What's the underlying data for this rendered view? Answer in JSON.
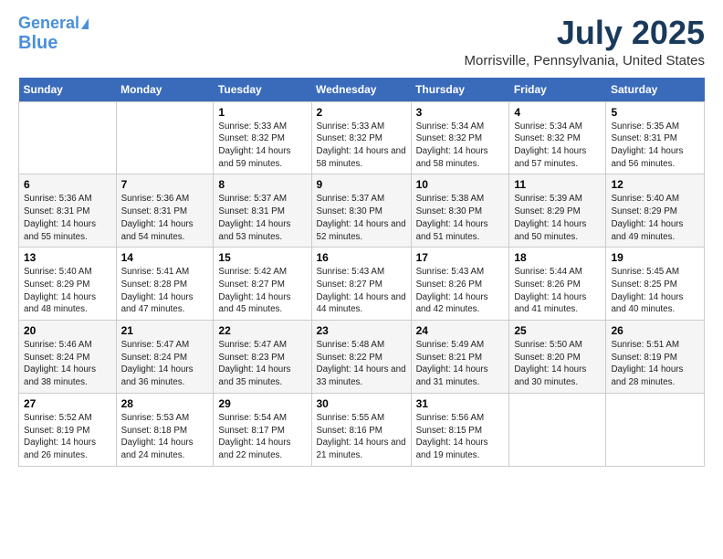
{
  "header": {
    "logo_line1": "General",
    "logo_line2": "Blue",
    "month": "July 2025",
    "location": "Morrisville, Pennsylvania, United States"
  },
  "days_of_week": [
    "Sunday",
    "Monday",
    "Tuesday",
    "Wednesday",
    "Thursday",
    "Friday",
    "Saturday"
  ],
  "weeks": [
    [
      {
        "day": "",
        "info": ""
      },
      {
        "day": "",
        "info": ""
      },
      {
        "day": "1",
        "info": "Sunrise: 5:33 AM\nSunset: 8:32 PM\nDaylight: 14 hours and 59 minutes."
      },
      {
        "day": "2",
        "info": "Sunrise: 5:33 AM\nSunset: 8:32 PM\nDaylight: 14 hours and 58 minutes."
      },
      {
        "day": "3",
        "info": "Sunrise: 5:34 AM\nSunset: 8:32 PM\nDaylight: 14 hours and 58 minutes."
      },
      {
        "day": "4",
        "info": "Sunrise: 5:34 AM\nSunset: 8:32 PM\nDaylight: 14 hours and 57 minutes."
      },
      {
        "day": "5",
        "info": "Sunrise: 5:35 AM\nSunset: 8:31 PM\nDaylight: 14 hours and 56 minutes."
      }
    ],
    [
      {
        "day": "6",
        "info": "Sunrise: 5:36 AM\nSunset: 8:31 PM\nDaylight: 14 hours and 55 minutes."
      },
      {
        "day": "7",
        "info": "Sunrise: 5:36 AM\nSunset: 8:31 PM\nDaylight: 14 hours and 54 minutes."
      },
      {
        "day": "8",
        "info": "Sunrise: 5:37 AM\nSunset: 8:31 PM\nDaylight: 14 hours and 53 minutes."
      },
      {
        "day": "9",
        "info": "Sunrise: 5:37 AM\nSunset: 8:30 PM\nDaylight: 14 hours and 52 minutes."
      },
      {
        "day": "10",
        "info": "Sunrise: 5:38 AM\nSunset: 8:30 PM\nDaylight: 14 hours and 51 minutes."
      },
      {
        "day": "11",
        "info": "Sunrise: 5:39 AM\nSunset: 8:29 PM\nDaylight: 14 hours and 50 minutes."
      },
      {
        "day": "12",
        "info": "Sunrise: 5:40 AM\nSunset: 8:29 PM\nDaylight: 14 hours and 49 minutes."
      }
    ],
    [
      {
        "day": "13",
        "info": "Sunrise: 5:40 AM\nSunset: 8:29 PM\nDaylight: 14 hours and 48 minutes."
      },
      {
        "day": "14",
        "info": "Sunrise: 5:41 AM\nSunset: 8:28 PM\nDaylight: 14 hours and 47 minutes."
      },
      {
        "day": "15",
        "info": "Sunrise: 5:42 AM\nSunset: 8:27 PM\nDaylight: 14 hours and 45 minutes."
      },
      {
        "day": "16",
        "info": "Sunrise: 5:43 AM\nSunset: 8:27 PM\nDaylight: 14 hours and 44 minutes."
      },
      {
        "day": "17",
        "info": "Sunrise: 5:43 AM\nSunset: 8:26 PM\nDaylight: 14 hours and 42 minutes."
      },
      {
        "day": "18",
        "info": "Sunrise: 5:44 AM\nSunset: 8:26 PM\nDaylight: 14 hours and 41 minutes."
      },
      {
        "day": "19",
        "info": "Sunrise: 5:45 AM\nSunset: 8:25 PM\nDaylight: 14 hours and 40 minutes."
      }
    ],
    [
      {
        "day": "20",
        "info": "Sunrise: 5:46 AM\nSunset: 8:24 PM\nDaylight: 14 hours and 38 minutes."
      },
      {
        "day": "21",
        "info": "Sunrise: 5:47 AM\nSunset: 8:24 PM\nDaylight: 14 hours and 36 minutes."
      },
      {
        "day": "22",
        "info": "Sunrise: 5:47 AM\nSunset: 8:23 PM\nDaylight: 14 hours and 35 minutes."
      },
      {
        "day": "23",
        "info": "Sunrise: 5:48 AM\nSunset: 8:22 PM\nDaylight: 14 hours and 33 minutes."
      },
      {
        "day": "24",
        "info": "Sunrise: 5:49 AM\nSunset: 8:21 PM\nDaylight: 14 hours and 31 minutes."
      },
      {
        "day": "25",
        "info": "Sunrise: 5:50 AM\nSunset: 8:20 PM\nDaylight: 14 hours and 30 minutes."
      },
      {
        "day": "26",
        "info": "Sunrise: 5:51 AM\nSunset: 8:19 PM\nDaylight: 14 hours and 28 minutes."
      }
    ],
    [
      {
        "day": "27",
        "info": "Sunrise: 5:52 AM\nSunset: 8:19 PM\nDaylight: 14 hours and 26 minutes."
      },
      {
        "day": "28",
        "info": "Sunrise: 5:53 AM\nSunset: 8:18 PM\nDaylight: 14 hours and 24 minutes."
      },
      {
        "day": "29",
        "info": "Sunrise: 5:54 AM\nSunset: 8:17 PM\nDaylight: 14 hours and 22 minutes."
      },
      {
        "day": "30",
        "info": "Sunrise: 5:55 AM\nSunset: 8:16 PM\nDaylight: 14 hours and 21 minutes."
      },
      {
        "day": "31",
        "info": "Sunrise: 5:56 AM\nSunset: 8:15 PM\nDaylight: 14 hours and 19 minutes."
      },
      {
        "day": "",
        "info": ""
      },
      {
        "day": "",
        "info": ""
      }
    ]
  ]
}
